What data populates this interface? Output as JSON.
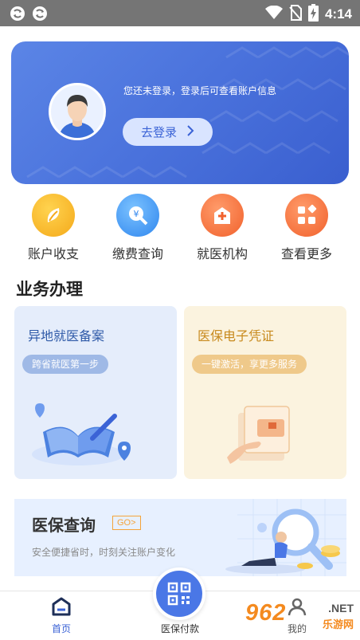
{
  "status_bar": {
    "time": "4:14",
    "icons": [
      "sync-icon",
      "sync-icon",
      "wifi-icon",
      "no-sim-icon",
      "battery-charging-icon"
    ]
  },
  "banner": {
    "message": "您还未登录，登录后可查看账户信息",
    "login_button": "去登录",
    "colors": {
      "start": "#5b85e6",
      "end": "#3a5fcf"
    }
  },
  "quick_menu": [
    {
      "label": "账户收支",
      "icon": "account-leaf-icon",
      "color": "#f7b21a"
    },
    {
      "label": "缴费查询",
      "icon": "payment-search-icon",
      "color": "#3f8ff0"
    },
    {
      "label": "就医机构",
      "icon": "hospital-icon",
      "color": "#f56b3a"
    },
    {
      "label": "查看更多",
      "icon": "more-grid-icon",
      "color": "#f56b3a"
    }
  ],
  "section": {
    "title": "业务办理"
  },
  "cards": [
    {
      "title": "异地就医备案",
      "tag": "跨省就医第一步",
      "title_color": "#2f5aa8",
      "tag_color": "#9fb9e6",
      "bg": "#e5edfb"
    },
    {
      "title": "医保电子凭证",
      "tag": "一键激活，享更多服务",
      "title_color": "#c88a1e",
      "tag_color": "#efc98a",
      "bg": "#fbf3df"
    }
  ],
  "promo": {
    "title": "医保查询",
    "go_label": "GO>",
    "description": "安全便捷省时，时刻关注账户变化"
  },
  "tab_bar": {
    "home": "首页",
    "pay": "医保付款",
    "mine": "我的",
    "accent": "#3b63d6"
  },
  "watermark": {
    "number": "962",
    "tld": ".NET",
    "site": "乐游网"
  }
}
